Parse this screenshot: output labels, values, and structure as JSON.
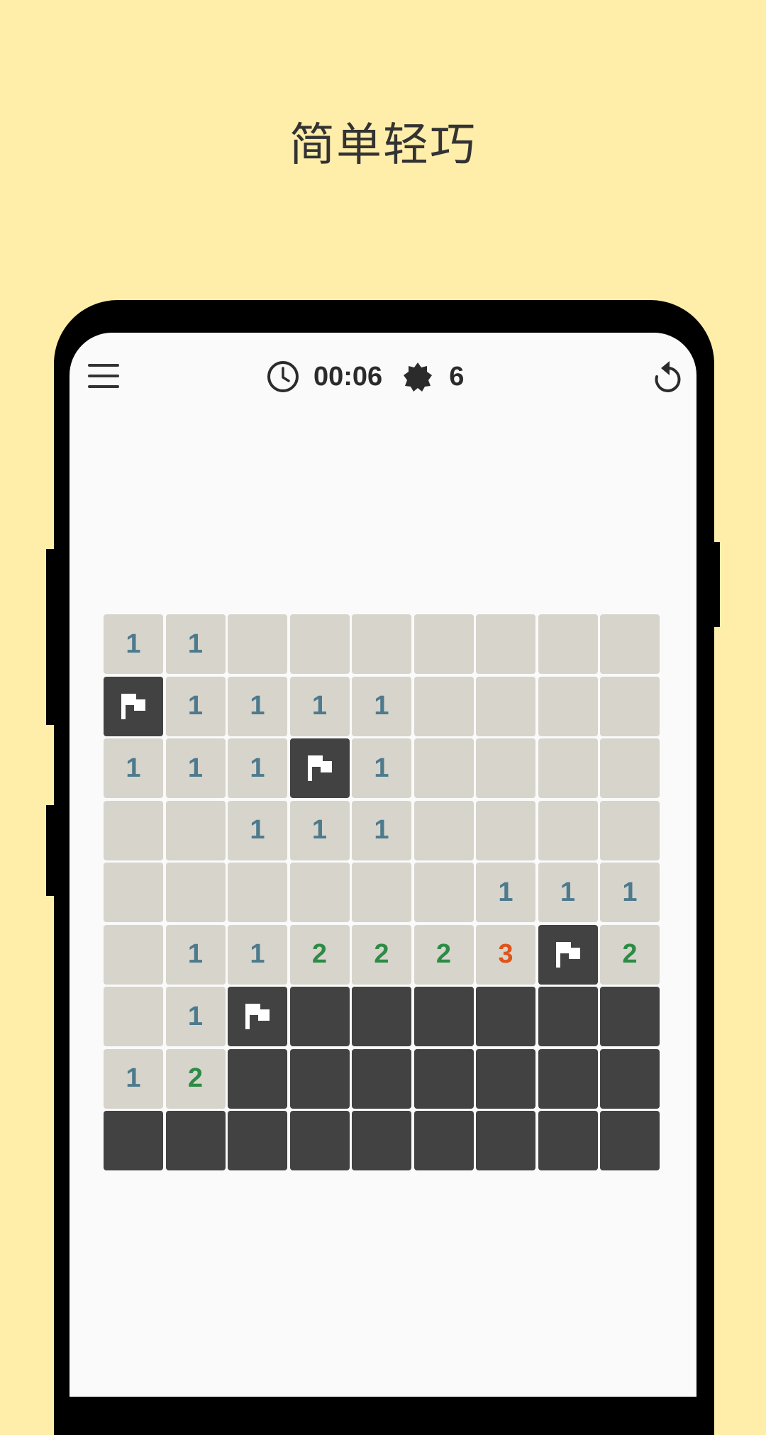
{
  "promo": {
    "headline": "简单轻巧"
  },
  "toolbar": {
    "menu_icon": "hamburger-menu-icon",
    "timer_icon": "clock-icon",
    "timer": "00:06",
    "mine_icon": "mine-icon",
    "mines_remaining": "6",
    "reset_icon": "restart-icon"
  },
  "colors": {
    "background": "#FFEEAA",
    "revealed_cell": "#D7D4CC",
    "hidden_cell": "#424242",
    "number_1": "#4D7A8C",
    "number_2": "#2E8B46",
    "number_3": "#E0531A"
  },
  "board": {
    "rows": 9,
    "cols": 9,
    "legend": "R = revealed empty, H = hidden, F = flagged, digit = revealed number",
    "cells": [
      [
        "1",
        "1",
        "R",
        "R",
        "R",
        "R",
        "R",
        "R",
        "R"
      ],
      [
        "F",
        "1",
        "1",
        "1",
        "1",
        "R",
        "R",
        "R",
        "R"
      ],
      [
        "1",
        "1",
        "1",
        "F",
        "1",
        "R",
        "R",
        "R",
        "R"
      ],
      [
        "R",
        "R",
        "1",
        "1",
        "1",
        "R",
        "R",
        "R",
        "R"
      ],
      [
        "R",
        "R",
        "R",
        "R",
        "R",
        "R",
        "1",
        "1",
        "1"
      ],
      [
        "R",
        "1",
        "1",
        "2",
        "2",
        "2",
        "3",
        "F",
        "2"
      ],
      [
        "R",
        "1",
        "F",
        "H",
        "H",
        "H",
        "H",
        "H",
        "H"
      ],
      [
        "1",
        "2",
        "H",
        "H",
        "H",
        "H",
        "H",
        "H",
        "H"
      ],
      [
        "H",
        "H",
        "H",
        "H",
        "H",
        "H",
        "H",
        "H",
        "H"
      ]
    ]
  }
}
